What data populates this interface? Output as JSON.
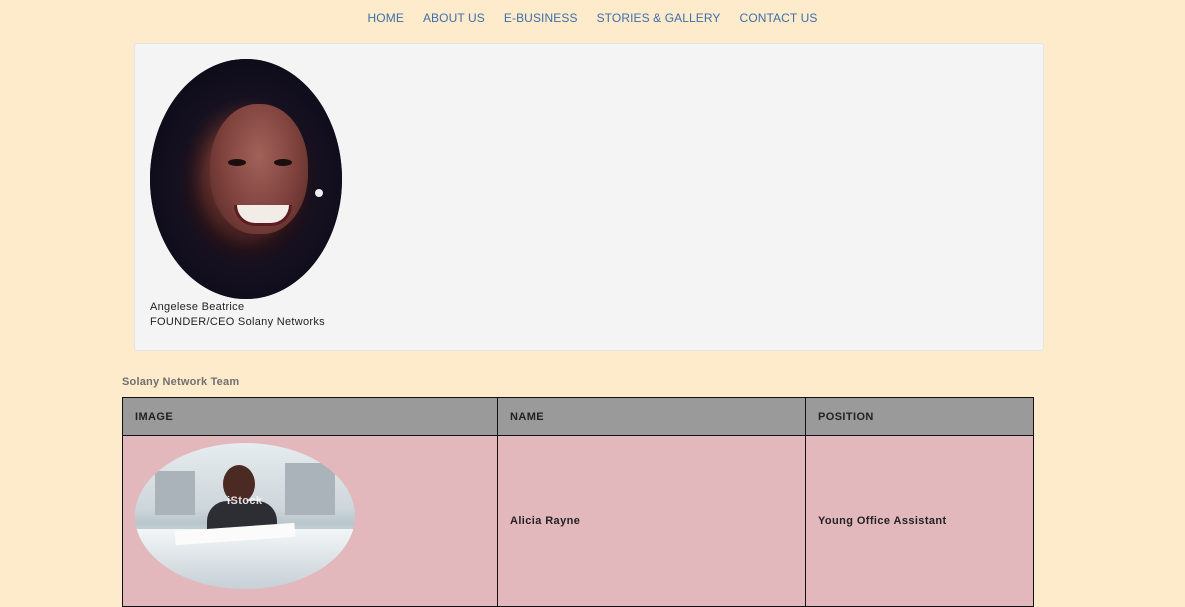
{
  "nav": {
    "items": [
      "HOME",
      "ABOUT US",
      "E-BUSINESS",
      "STORIES & GALLERY",
      "CONTACT US"
    ]
  },
  "profile": {
    "name": "Angelese Beatrice",
    "title": "FOUNDER/CEO Solany Networks"
  },
  "team": {
    "heading": "Solany Network Team",
    "columns": [
      "IMAGE",
      "NAME",
      "POSITION"
    ],
    "rows": [
      {
        "name": "Alicia Rayne",
        "position": "Young Office Assistant",
        "watermark": "iStock"
      }
    ]
  },
  "colors": {
    "background": "#feebcb",
    "nav_link": "#3f6ea8",
    "header_row": "#9a9a9a",
    "body_row": "#e3b8bd",
    "card": "#f4f4f4"
  }
}
